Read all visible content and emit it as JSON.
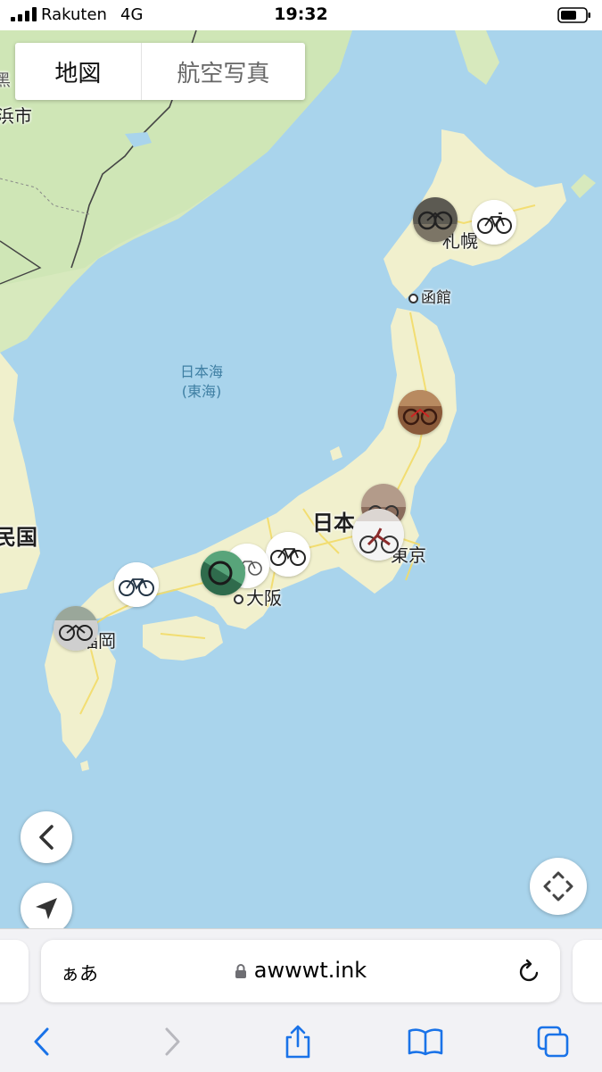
{
  "status_bar": {
    "carrier": "Rakuten",
    "network": "4G",
    "time": "19:32"
  },
  "map_toggle": {
    "map_label": "地図",
    "aerial_label": "航空写真"
  },
  "map_labels": {
    "sapporo": "札幌",
    "hakodate": "函館",
    "sea_of_japan_line1": "日本海",
    "sea_of_japan_line2": "(東海)",
    "japan": "日本",
    "tokyo": "東京",
    "osaka": "大阪",
    "fukuoka": "福岡",
    "korea_partial": "民国",
    "city_partial": "浜市",
    "edge_partial": "黑"
  },
  "browser": {
    "aa_label": "ぁあ",
    "url": "awwwt.ink"
  },
  "colors": {
    "sea": "#a9d4ec",
    "land": "#f3f1d0",
    "land_green": "#cfe6b6",
    "accent_blue": "#1a73e8"
  },
  "icons": {
    "back": "chevron-left-icon",
    "location": "navigation-arrow-icon",
    "expand": "expand-arrows-icon",
    "lock": "lock-icon",
    "reload": "reload-icon",
    "share": "share-icon",
    "bookmarks": "book-icon",
    "tabs": "tabs-icon"
  }
}
